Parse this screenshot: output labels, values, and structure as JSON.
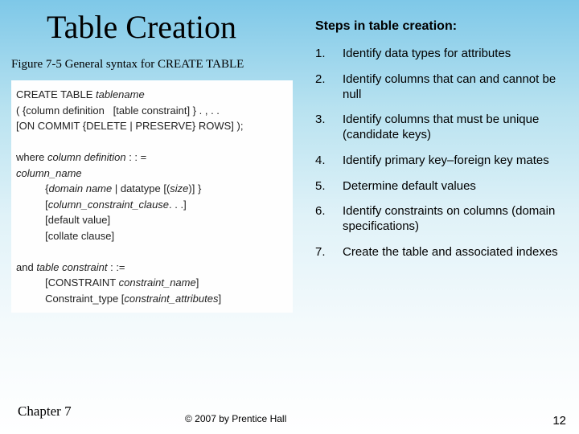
{
  "title": "Table Creation",
  "caption": "Figure 7-5 General syntax for CREATE TABLE",
  "syntax": {
    "l1a": "CREATE TABLE ",
    "l1b": "tablename",
    "l2a": "( {column definition   [table constraint] } . , . .",
    "l3a": "[ON COMMIT {DELETE | PRESERVE} ROWS] );",
    "l5a": "where ",
    "l5b": "column definition",
    "l5c": " : : =",
    "l6a": "column_name",
    "l7a": "          {",
    "l7b": "domain name",
    "l7c": " | datatype [(",
    "l7d": "size",
    "l7e": ")] }",
    "l8a": "          [",
    "l8b": "column_constraint_clause",
    "l8c": ". . .]",
    "l9a": "          [default value]",
    "l10a": "          [collate clause]",
    "l12a": "and ",
    "l12b": "table constraint",
    "l12c": " : :=",
    "l13a": "          [CONSTRAINT ",
    "l13b": "constraint_name",
    "l13c": "]",
    "l14a": "          Constraint_type [",
    "l14b": "constraint_attributes",
    "l14c": "]"
  },
  "steps_heading": "Steps in table creation:",
  "steps": [
    "Identify data types for attributes",
    "Identify columns that can and cannot be null",
    "Identify columns that must be unique (candidate keys)",
    "Identify primary key–foreign key mates",
    "Determine default values",
    "Identify constraints on columns (domain specifications)",
    "Create the table and associated indexes"
  ],
  "footer": {
    "left": "Chapter 7",
    "center": "© 2007 by Prentice Hall",
    "right": "12"
  }
}
